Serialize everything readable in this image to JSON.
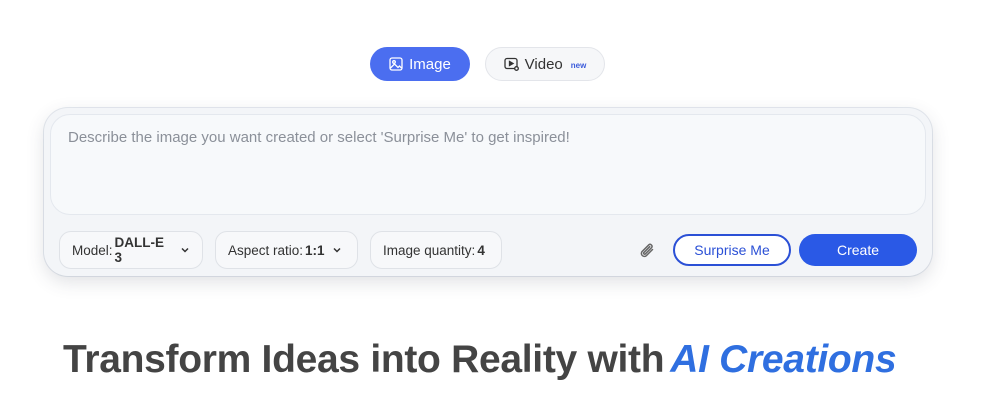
{
  "tabs": [
    {
      "label": "Image",
      "icon": "image-icon",
      "active": true
    },
    {
      "label": "Video",
      "icon": "video-icon",
      "badge": "new",
      "active": false
    }
  ],
  "prompt": {
    "placeholder": "Describe the image you want created or select 'Surprise Me' to get inspired!",
    "value": ""
  },
  "options": {
    "model": {
      "label": "Model:",
      "value": "DALL-E 3"
    },
    "aspect_ratio": {
      "label": "Aspect ratio:",
      "value": "1:1"
    },
    "image_quantity": {
      "label": "Image quantity:",
      "value": "4"
    }
  },
  "actions": {
    "attach_icon": "paperclip-icon",
    "surprise_label": "Surprise Me",
    "create_label": "Create"
  },
  "headline": {
    "main": "Transform Ideas into Reality with",
    "accent": "AI Creations"
  },
  "colors": {
    "primary": "#2a59e6",
    "active_tab": "#4b6ef0",
    "accent_text": "#2f6fe0",
    "headline_text": "#444444"
  }
}
